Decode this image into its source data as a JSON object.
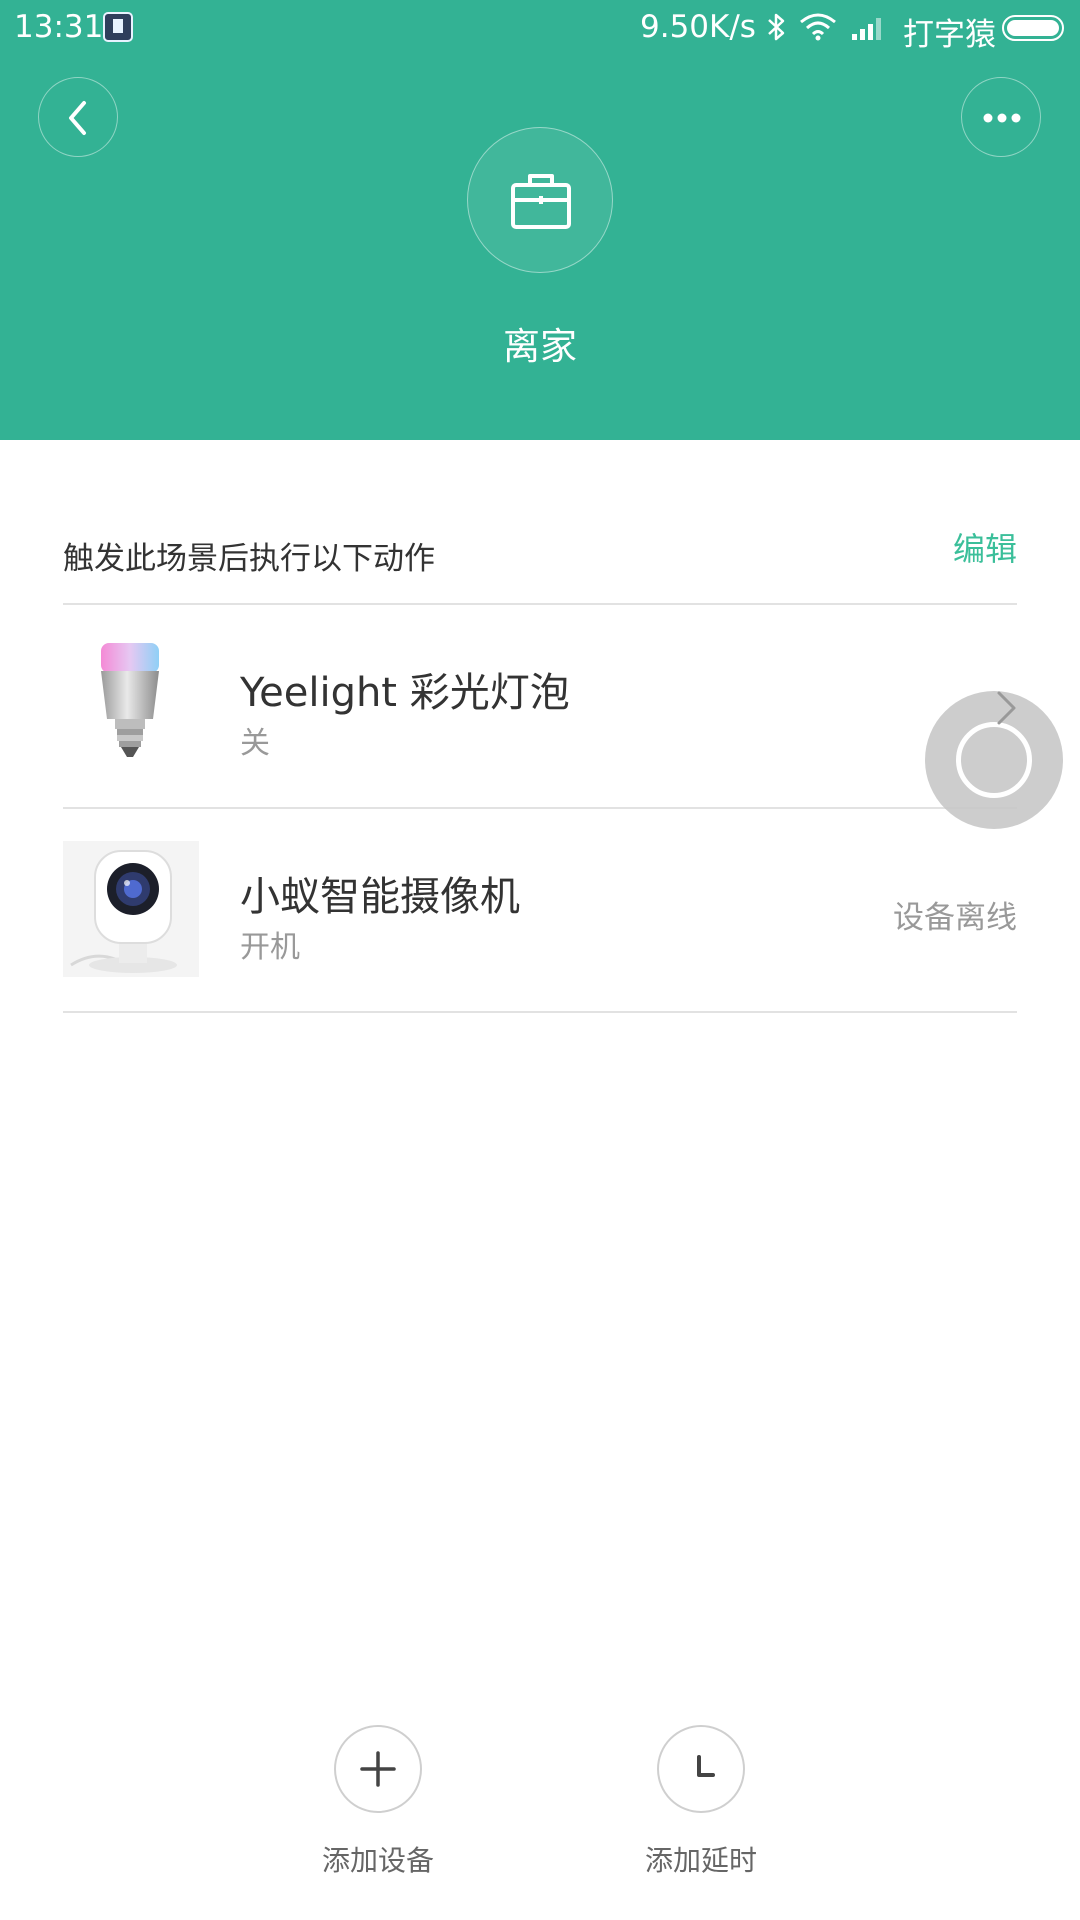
{
  "status_bar": {
    "time": "13:31",
    "network_speed": "9.50K/s",
    "carrier": "打字猿",
    "icons": [
      "notification-icon",
      "bluetooth-icon",
      "wifi-icon",
      "signal-icon",
      "battery-icon"
    ]
  },
  "header": {
    "background_color": "#33b294",
    "back_icon": "chevron-left-icon",
    "more_icon": "more-horizontal-icon",
    "scene_icon": "briefcase-icon",
    "scene_name": "离家"
  },
  "actions": {
    "title": "触发此场景后执行以下动作",
    "edit_label": "编辑",
    "items": [
      {
        "name": "Yeelight 彩光灯泡",
        "action": "关",
        "status": "",
        "image": "yeelight-bulb-image"
      },
      {
        "name": "小蚁智能摄像机",
        "action": "开机",
        "status": "设备离线",
        "image": "yi-camera-image"
      }
    ]
  },
  "bottom": {
    "add_device_label": "添加设备",
    "add_delay_label": "添加延时"
  },
  "colors": {
    "accent": "#3bbf9a",
    "header": "#33b294",
    "muted_text": "#999999"
  }
}
